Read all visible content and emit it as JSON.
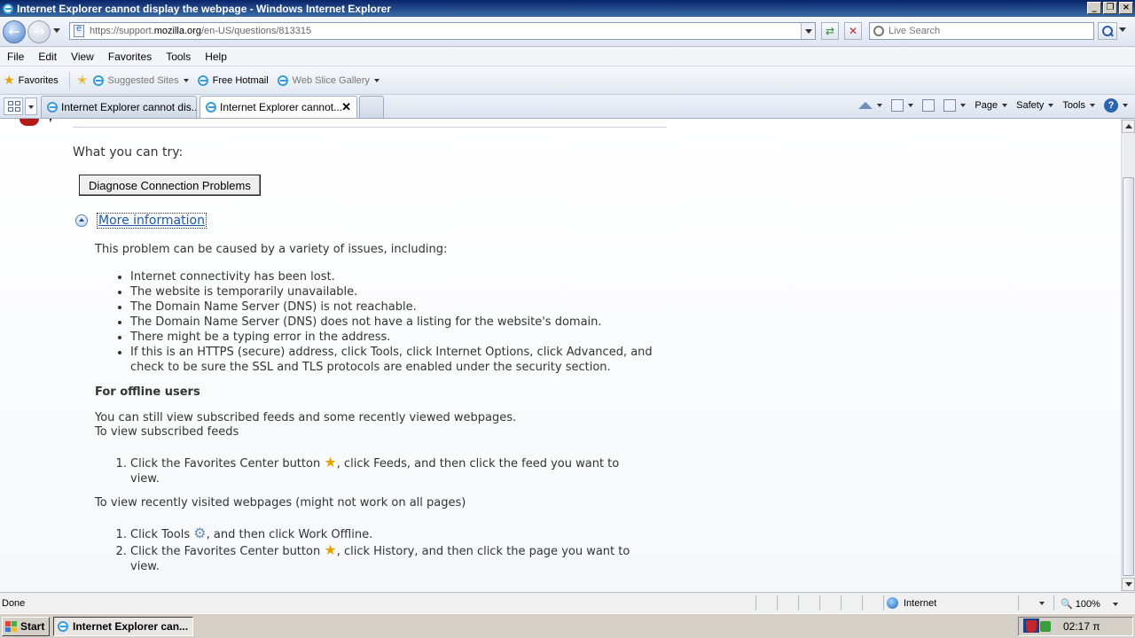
{
  "window": {
    "title": "Internet Explorer cannot display the webpage - Windows Internet Explorer",
    "controls": [
      "_",
      "❐",
      "×"
    ]
  },
  "nav": {
    "url_prefix": "https://support.",
    "url_domain": "mozilla.org",
    "url_path": "/en-US/questions/813315",
    "search_placeholder": "Live Search"
  },
  "menu": {
    "items": [
      "File",
      "Edit",
      "View",
      "Favorites",
      "Tools",
      "Help"
    ]
  },
  "favorites": {
    "label": "Favorites",
    "suggested": "Suggested Sites",
    "hotmail": "Free Hotmail",
    "webslice": "Web Slice Gallery"
  },
  "tabs": [
    {
      "label": "Internet Explorer cannot dis..."
    },
    {
      "label": "Internet Explorer cannot..."
    }
  ],
  "commands": {
    "page": "Page",
    "safety": "Safety",
    "tools": "Tools"
  },
  "content": {
    "what_try": "What you can try:",
    "diagnose_button": "Diagnose Connection Problems",
    "more_info": "More information",
    "intro": "This problem can be caused by a variety of issues, including:",
    "causes": [
      "Internet connectivity has been lost.",
      "The website is temporarily unavailable.",
      "The Domain Name Server (DNS) is not reachable.",
      "The Domain Name Server (DNS) does not have a listing for the website's domain.",
      "There might be a typing error in the address.",
      "If this is an HTTPS (secure) address, click Tools, click Internet Options, click Advanced, and check to be sure the SSL and TLS protocols are enabled under the security section."
    ],
    "offline_heading": "For offline users",
    "offline_p1": "You can still view subscribed feeds and some recently viewed webpages.",
    "offline_p2": "To view subscribed feeds",
    "feeds_step_a": "Click the Favorites Center button",
    "feeds_step_b": ", click Feeds, and then click the feed you want to view.",
    "recent_intro": "To view recently visited webpages (might not work on all pages)",
    "recent_step1_a": "Click Tools",
    "recent_step1_b": ", and then click Work Offline.",
    "recent_step2_a": "Click the Favorites Center button",
    "recent_step2_b": ", click History, and then click the page you want to view."
  },
  "status": {
    "text": "Done",
    "zone": "Internet",
    "zoom": "100%"
  },
  "taskbar": {
    "start": "Start",
    "task": "Internet Explorer can...",
    "lang": "EN",
    "clock": "02:17 π"
  }
}
